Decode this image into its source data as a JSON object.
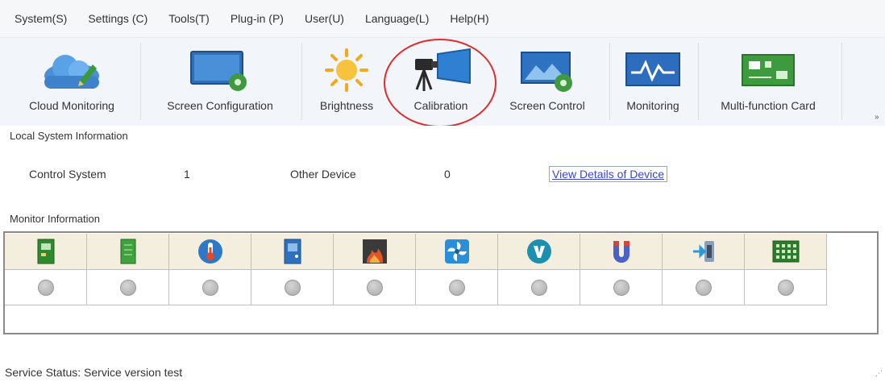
{
  "menu": {
    "items": [
      {
        "label": "System(S)"
      },
      {
        "label": "Settings (C)"
      },
      {
        "label": "Tools(T)"
      },
      {
        "label": "Plug-in (P)"
      },
      {
        "label": "User(U)"
      },
      {
        "label": "Language(L)"
      },
      {
        "label": "Help(H)"
      }
    ]
  },
  "toolbar": {
    "items": [
      {
        "label": "Cloud Monitoring",
        "icon": "cloud-edit-icon"
      },
      {
        "label": "Screen Configuration",
        "icon": "screen-config-icon"
      },
      {
        "label": "Brightness",
        "icon": "sun-icon"
      },
      {
        "label": "Calibration",
        "icon": "camera-calibration-icon"
      },
      {
        "label": "Screen Control",
        "icon": "screen-control-icon"
      },
      {
        "label": "Monitoring",
        "icon": "monitor-wave-icon"
      },
      {
        "label": "Multi-function Card",
        "icon": "circuit-card-icon"
      }
    ],
    "overflow": "»"
  },
  "annotation": {
    "number": "1",
    "color": "#e02b2b"
  },
  "local_info": {
    "title": "Local System Information",
    "control_system_label": "Control System",
    "control_system_value": "1",
    "other_device_label": "Other Device",
    "other_device_value": "0",
    "details_link": "View Details of Device"
  },
  "monitor": {
    "title": "Monitor Information",
    "columns": [
      {
        "icon": "receiving-card-icon"
      },
      {
        "icon": "module-board-icon"
      },
      {
        "icon": "temperature-icon"
      },
      {
        "icon": "cabinet-door-icon"
      },
      {
        "icon": "smoke-fire-icon"
      },
      {
        "icon": "fan-icon"
      },
      {
        "icon": "voltage-icon"
      },
      {
        "icon": "magnet-icon"
      },
      {
        "icon": "power-plug-icon"
      },
      {
        "icon": "led-module-icon"
      }
    ],
    "status": "unknown"
  },
  "status_bar": {
    "text": "Service Status:  Service version test"
  },
  "colors": {
    "accent_link": "#3a47c4",
    "annotation_red": "#e02b2b",
    "grid_header": "#f4eede"
  }
}
